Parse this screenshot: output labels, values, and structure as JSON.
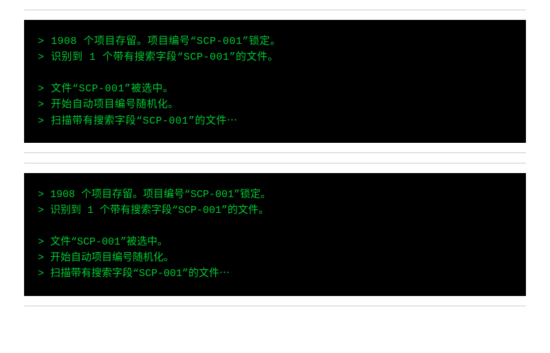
{
  "blocks": [
    {
      "style": "wide",
      "sections": [
        [
          "> 1908 个项目存留。项目编号“SCP-001”锁定。",
          "> 识别到 1 个带有搜索字段“SCP-001”的文件。"
        ],
        [
          "> 文件“SCP-001”被选中。",
          "> 开始自动项目编号随机化。",
          "> 扫描带有搜索字段“SCP-001”的文件⋯"
        ]
      ]
    },
    {
      "style": "normal",
      "sections": [
        [
          "> 1908 个项目存留。项目编号“SCP-001”锁定。",
          "> 识别到 1 个带有搜索字段“SCP-001”的文件。"
        ],
        [
          "> 文件“SCP-001”被选中。",
          "> 开始自动项目编号随机化。",
          "> 扫描带有搜索字段“SCP-001”的文件⋯"
        ]
      ]
    }
  ]
}
